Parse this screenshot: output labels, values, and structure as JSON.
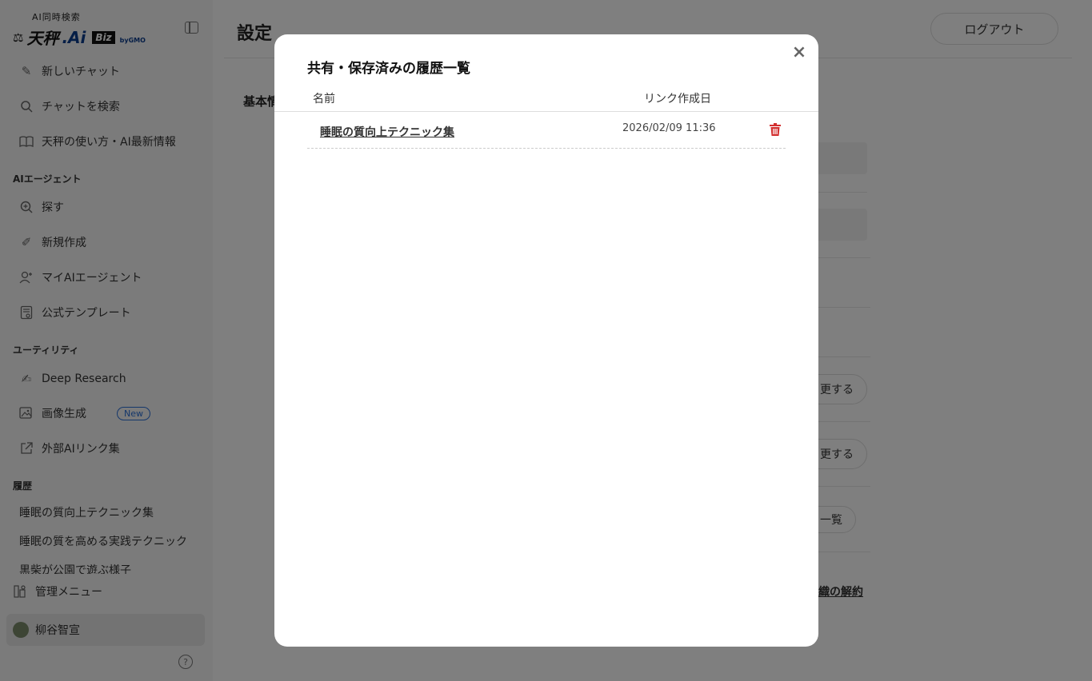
{
  "sidebar": {
    "logo": {
      "subtitle": "AI同時検索",
      "brand": "天秤",
      "brand_ai": ".Ai",
      "biz": "Biz",
      "by": "byGMO"
    },
    "top_items": [
      {
        "label": "新しいチャット",
        "icon": "edit-icon"
      },
      {
        "label": "チャットを検索",
        "icon": "search-icon"
      },
      {
        "label": "天秤の使い方・AI最新情報",
        "icon": "book-icon"
      }
    ],
    "agent_section": "AIエージェント",
    "agent_items": [
      {
        "label": "探す",
        "icon": "zoom-icon"
      },
      {
        "label": "新規作成",
        "icon": "pen-sparkle-icon"
      },
      {
        "label": "マイAIエージェント",
        "icon": "user-plus-icon"
      },
      {
        "label": "公式テンプレート",
        "icon": "template-icon"
      }
    ],
    "utility_section": "ユーティリティ",
    "utility_items": [
      {
        "label": "Deep Research",
        "icon": "research-icon"
      },
      {
        "label": "画像生成",
        "icon": "image-icon",
        "badge": "New"
      },
      {
        "label": "外部AIリンク集",
        "icon": "external-link-icon"
      }
    ],
    "history_section": "履歴",
    "history_items": [
      "睡眠の質向上テクニック集",
      "睡眠の質を高める実践テクニック",
      "黒柴が公園で遊ぶ様子"
    ],
    "admin_label": "管理メニュー",
    "user_name": "柳谷智宣",
    "help_symbol": "?"
  },
  "main": {
    "title": "設定",
    "logout_label": "ログアウト",
    "section_heading": "基本情",
    "button_change_1": "更する",
    "button_change_2": "更する",
    "button_list": "一覧",
    "link_cancel": "織の解約"
  },
  "modal": {
    "title": "共有・保存済みの履歴一覧",
    "close_symbol": "×",
    "columns": {
      "name": "名前",
      "date": "リンク作成日"
    },
    "rows": [
      {
        "name": "睡眠の質向上テクニック集",
        "date": "2026/02/09 11:36"
      }
    ]
  },
  "colors": {
    "danger": "#d32f2f",
    "accent": "#2a6fd6",
    "overlay": "rgba(0,0,0,0.5)"
  }
}
